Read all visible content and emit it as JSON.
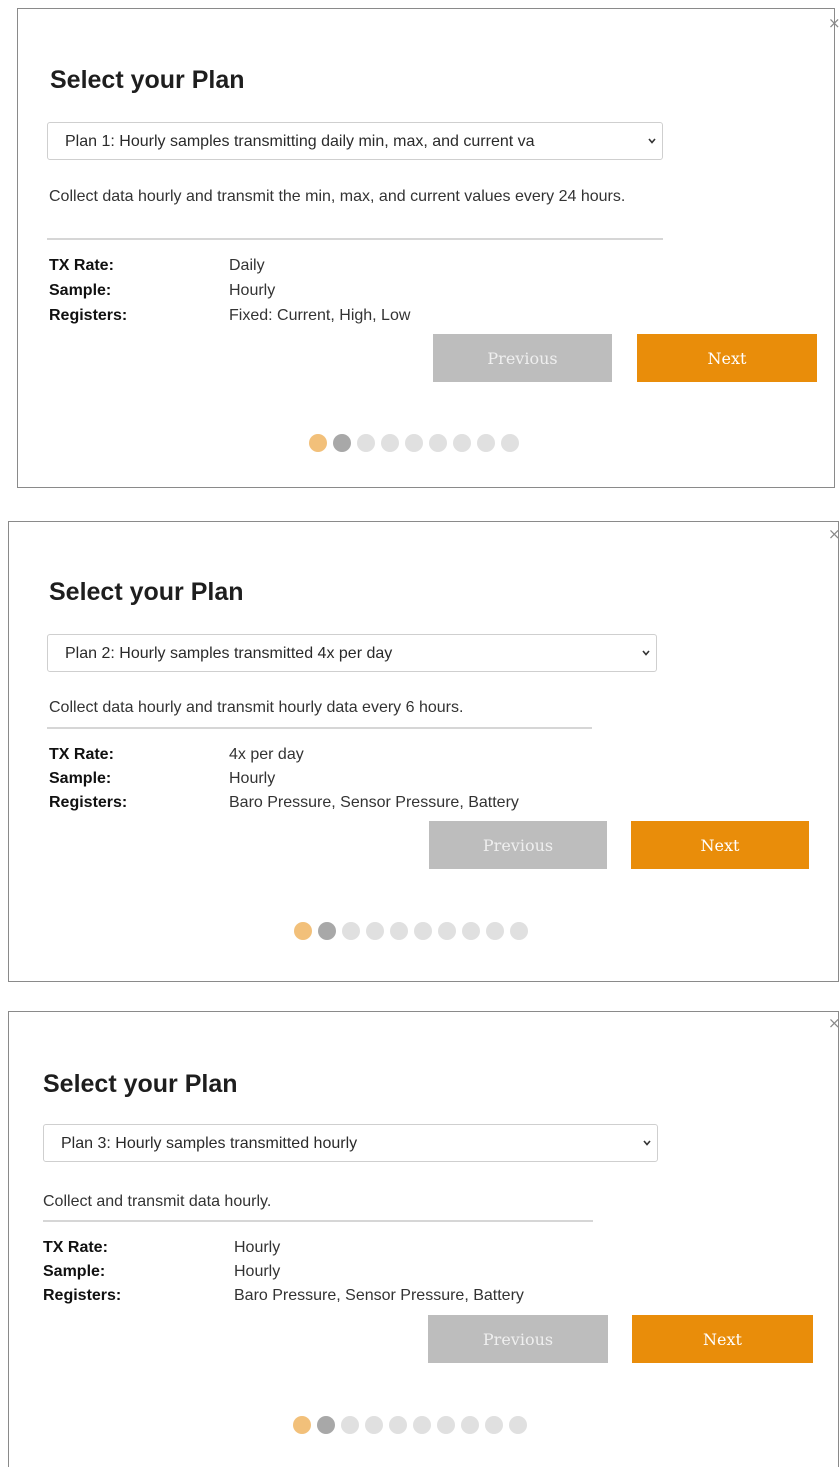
{
  "colors": {
    "accent": "#e98d0a",
    "button_disabled": "#bdbdbd",
    "dot_active": "#f2c07a",
    "dot_second": "#a8a8a8",
    "dot_inactive": "#e0e0e0"
  },
  "close_glyph": "×",
  "labels": {
    "tx_rate": "TX Rate:",
    "sample": "Sample:",
    "registers": "Registers:"
  },
  "panels": [
    {
      "title": "Select your Plan",
      "plan_select": "Plan 1: Hourly samples transmitting daily min, max, and current va",
      "description": "Collect data hourly and transmit the min, max, and current values every 24 hours.",
      "tx_rate": "Daily",
      "sample": "Hourly",
      "registers": "Fixed: Current, High, Low",
      "previous_label": "Previous",
      "next_label": "Next",
      "pager": {
        "total": 9,
        "active_index": 0
      }
    },
    {
      "title": "Select your Plan",
      "plan_select": "Plan 2: Hourly samples transmitted 4x per day",
      "description": "Collect data hourly and transmit hourly data every 6 hours.",
      "tx_rate": "4x per day",
      "sample": "Hourly",
      "registers": "Baro Pressure, Sensor Pressure, Battery",
      "previous_label": "Previous",
      "next_label": "Next",
      "pager": {
        "total": 10,
        "active_index": 0
      }
    },
    {
      "title": "Select your Plan",
      "plan_select": "Plan 3: Hourly samples transmitted hourly",
      "description": "Collect and transmit data hourly.",
      "tx_rate": "Hourly",
      "sample": "Hourly",
      "registers": "Baro Pressure, Sensor Pressure, Battery",
      "previous_label": "Previous",
      "next_label": "Next",
      "pager": {
        "total": 10,
        "active_index": 0
      }
    }
  ]
}
